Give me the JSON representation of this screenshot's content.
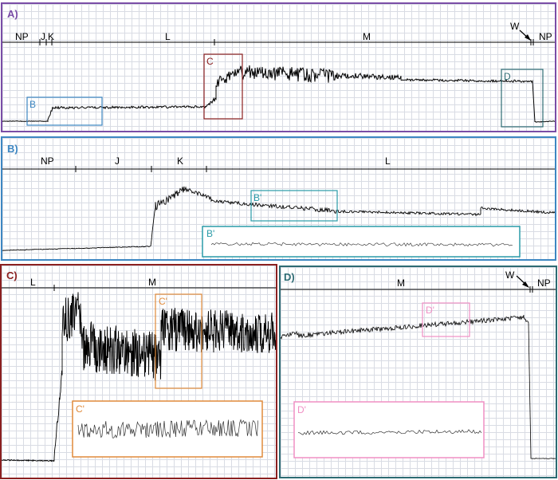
{
  "panels": {
    "A": {
      "label": "A)",
      "phase_labels": [
        "NP",
        "J",
        "K",
        "L",
        "M",
        "W",
        "NP"
      ],
      "inset_labels": [
        "B",
        "C",
        "D"
      ],
      "colors": {
        "border": "#7a4da6",
        "B": "#3d87c2",
        "C": "#8b2020",
        "D": "#2d6b73"
      }
    },
    "B": {
      "label": "B)",
      "phase_labels": [
        "NP",
        "J",
        "K",
        "L"
      ],
      "inset_label": "B'",
      "detail_label": "B'",
      "colors": {
        "border": "#3d87c2",
        "inset": "#2a9ba8"
      }
    },
    "C": {
      "label": "C)",
      "phase_labels": [
        "L",
        "M"
      ],
      "inset_label": "C'",
      "detail_label": "C'",
      "colors": {
        "border": "#8b2020",
        "inset": "#e08a3a"
      }
    },
    "D": {
      "label": "D)",
      "phase_labels": [
        "M",
        "W",
        "NP"
      ],
      "inset_label": "D'",
      "detail_label": "D'",
      "colors": {
        "border": "#2d6b73",
        "inset": "#f08fc4"
      }
    }
  }
}
